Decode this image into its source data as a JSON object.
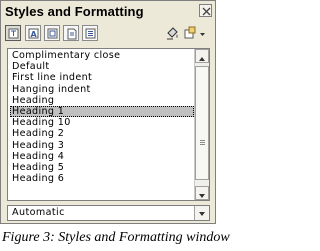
{
  "window": {
    "title": "Styles and Formatting"
  },
  "toolbar": {
    "buttons": [
      {
        "icon": "paragraph-styles-icon"
      },
      {
        "icon": "character-styles-icon"
      },
      {
        "icon": "frame-styles-icon"
      },
      {
        "icon": "page-styles-icon"
      },
      {
        "icon": "list-styles-icon"
      },
      {
        "icon": "fill-format-mode-icon"
      },
      {
        "icon": "new-style-from-selection-icon"
      }
    ]
  },
  "styles_list": {
    "items": [
      "Complimentary close",
      "Default",
      "First line indent",
      "Hanging indent",
      "Heading",
      "Heading 1",
      "Heading 10",
      "Heading 2",
      "Heading 3",
      "Heading 4",
      "Heading 5",
      "Heading 6"
    ],
    "selected_index": 5
  },
  "filter": {
    "value": "Automatic"
  },
  "caption": "Figure 3: Styles and Formatting window"
}
